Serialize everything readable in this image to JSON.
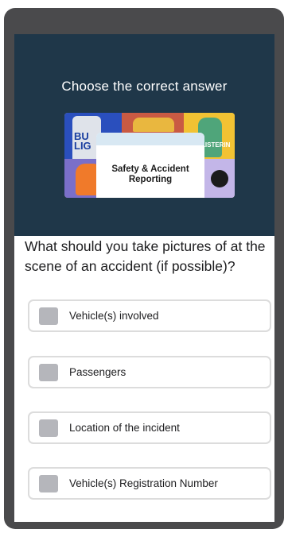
{
  "header": {
    "prompt": "Choose the correct answer",
    "thumbnail_title_line1": "Safety & Accident",
    "thumbnail_title_line2": "Reporting",
    "thumbnail_can_text": "BU\nLIG",
    "thumbnail_bottle_text": "LISTERIN"
  },
  "question": {
    "text": "What should you take pictures of at the scene of an accident (if possible)?"
  },
  "options": [
    {
      "label": "Vehicle(s) involved",
      "checked": false
    },
    {
      "label": "Passengers",
      "checked": false
    },
    {
      "label": "Location of the incident",
      "checked": false
    },
    {
      "label": "Vehicle(s) Registration Number",
      "checked": false
    }
  ],
  "colors": {
    "header_bg": "#1f3749",
    "frame": "#4a4a4c",
    "checkbox": "#b5b6bb",
    "option_border": "#dcdcdc"
  }
}
